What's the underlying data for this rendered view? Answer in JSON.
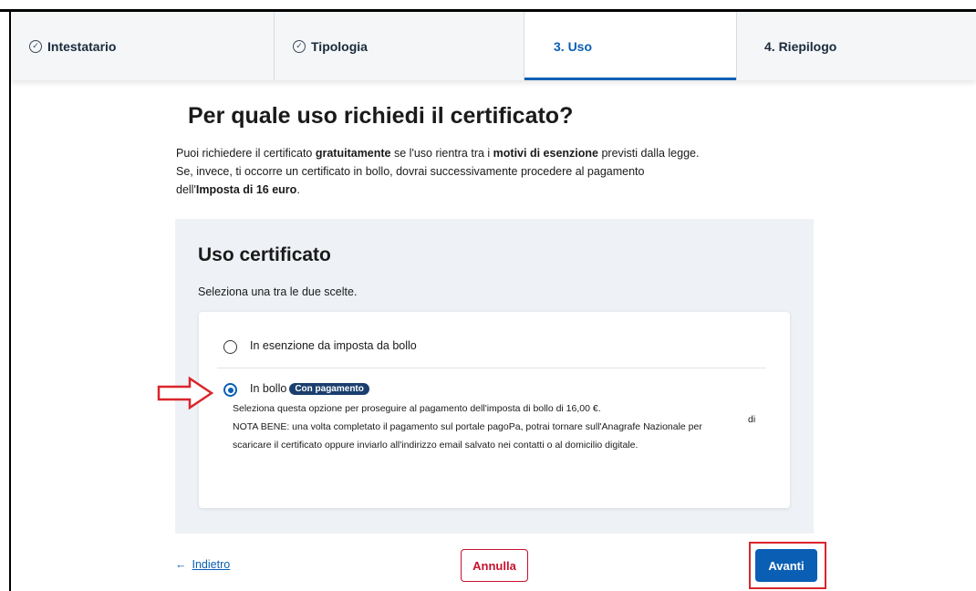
{
  "stepper": {
    "steps": [
      {
        "label": "Intestatario",
        "state": "done"
      },
      {
        "label": "Tipologia",
        "state": "done"
      },
      {
        "label": "3. Uso",
        "state": "active"
      },
      {
        "label": "4. Riepilogo",
        "state": "pending"
      }
    ]
  },
  "page": {
    "title": "Per quale uso richiedi il certificato?",
    "intro": {
      "p1": "Puoi richiedere il certificato ",
      "b1": "gratuitamente",
      "p2": " se l'uso rientra tra i ",
      "b2": "motivi di esenzione",
      "p3": " previsti dalla legge.",
      "line2": "Se, invece, ti occorre un certificato in bollo, dovrai successivamente procedere al pagamento",
      "p4": "dell'",
      "b3": "Imposta di 16 euro",
      "p5": "."
    }
  },
  "card": {
    "title": "Uso certificato",
    "subtitle": "Seleziona una tra le due scelte.",
    "options": [
      {
        "label": "In esenzione da imposta da bollo",
        "selected": false
      },
      {
        "label": "In bollo",
        "badge": "Con pagamento",
        "selected": true,
        "desc_line1": "Seleziona questa opzione per proseguire al pagamento dell'imposta di bollo di 16,00 €.",
        "desc_line2": "NOTA BENE: una volta completato il pagamento sul portale pagoPa, potrai tornare sull'Anagrafe Nazionale per",
        "desc_line3": "scaricare il certificato oppure inviarlo all'indirizzo email salvato nei contatti o al domicilio digitale.",
        "trailing": "di"
      }
    ]
  },
  "actions": {
    "back_arrow": "←",
    "back_label": "Indietro",
    "cancel_label": "Annulla",
    "next_label": "Avanti"
  },
  "colors": {
    "accent": "#0a5fb4",
    "cancel": "#c8102e",
    "highlight": "#d9252b",
    "badge": "#1a3e6e"
  }
}
